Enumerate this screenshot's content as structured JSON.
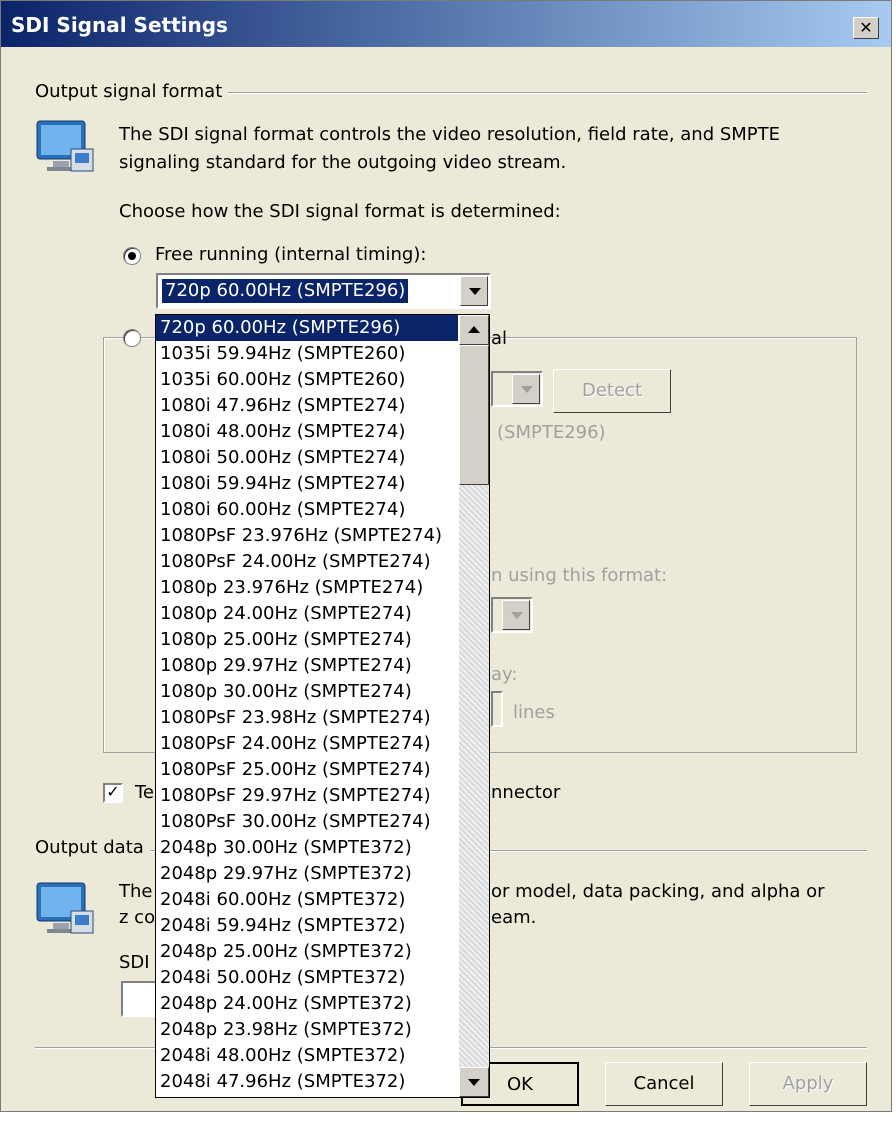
{
  "window": {
    "title": "SDI Signal Settings"
  },
  "output_signal": {
    "group_label": "Output signal format",
    "description": "The SDI signal format controls the video resolution, field rate, and SMPTE signaling standard for the outgoing video stream.",
    "choose_label": "Choose how the SDI signal format is determined:",
    "free_running_label": "Free running (internal timing):",
    "selected_format": "720p 60.00Hz (SMPTE296)",
    "option2_tail": "al",
    "detect_button": "Detect",
    "detected_text": "(SMPTE296)",
    "using_format_text": "n using this format:",
    "delay_text": "ay:",
    "lines_label": "lines",
    "checkbox_prefix": "Te",
    "checkbox_suffix": "nnector"
  },
  "output_data": {
    "group_label_prefix": "Output data",
    "line1_prefix": "The",
    "line1_suffix": "or model, data packing, and alpha or",
    "line2_prefix": "z co",
    "line2_suffix": "eam.",
    "sdi_label_prefix": "SDI"
  },
  "dropdown": {
    "options": [
      "720p 60.00Hz (SMPTE296)",
      "1035i 59.94Hz (SMPTE260)",
      "1035i 60.00Hz (SMPTE260)",
      "1080i 47.96Hz (SMPTE274)",
      "1080i 48.00Hz (SMPTE274)",
      "1080i 50.00Hz (SMPTE274)",
      "1080i 59.94Hz (SMPTE274)",
      "1080i 60.00Hz (SMPTE274)",
      "1080PsF 23.976Hz (SMPTE274)",
      "1080PsF 24.00Hz (SMPTE274)",
      "1080p 23.976Hz (SMPTE274)",
      "1080p 24.00Hz (SMPTE274)",
      "1080p 25.00Hz (SMPTE274)",
      "1080p 29.97Hz (SMPTE274)",
      "1080p 30.00Hz (SMPTE274)",
      "1080PsF 23.98Hz (SMPTE274)",
      "1080PsF 24.00Hz (SMPTE274)",
      "1080PsF 25.00Hz (SMPTE274)",
      "1080PsF 29.97Hz (SMPTE274)",
      "1080PsF 30.00Hz (SMPTE274)",
      "2048p 30.00Hz (SMPTE372)",
      "2048p 29.97Hz (SMPTE372)",
      "2048i 60.00Hz (SMPTE372)",
      "2048i 59.94Hz (SMPTE372)",
      "2048p 25.00Hz (SMPTE372)",
      "2048i 50.00Hz (SMPTE372)",
      "2048p 24.00Hz (SMPTE372)",
      "2048p 23.98Hz (SMPTE372)",
      "2048i 48.00Hz (SMPTE372)",
      "2048i 47.96Hz (SMPTE372)"
    ],
    "selected_index": 0
  },
  "buttons": {
    "ok": "OK",
    "cancel": "Cancel",
    "apply": "Apply"
  },
  "colors": {
    "title_start": "#0a246a",
    "title_end": "#a6caf0",
    "dialog_bg": "#ece9d8",
    "selection": "#0a246a"
  }
}
